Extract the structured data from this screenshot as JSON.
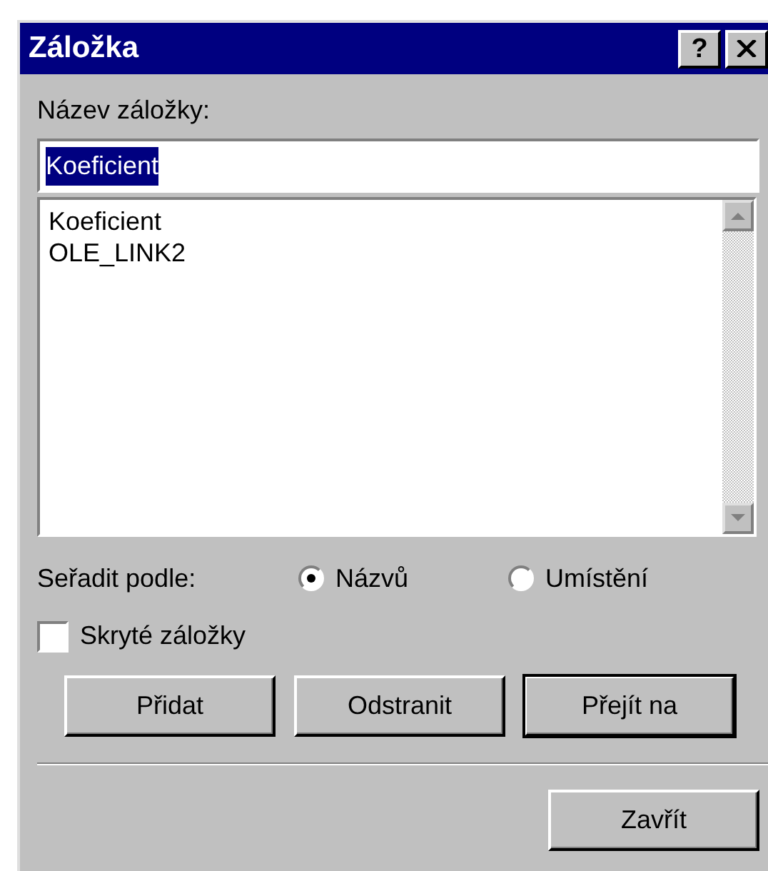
{
  "window": {
    "title": "Záložka"
  },
  "title_buttons": [
    {
      "kind": "help",
      "label": "?"
    },
    {
      "kind": "close"
    }
  ],
  "name_field": {
    "label": "Název záložky:",
    "value": "Koeficient",
    "text_selected": true
  },
  "bookmarks": [
    {
      "label": "Koeficient",
      "selected": false
    },
    {
      "label": "OLE_LINK2",
      "selected": false
    }
  ],
  "sort": {
    "label": "Seřadit podle:",
    "options": [
      {
        "label": "Názvů",
        "selected": true
      },
      {
        "label": "Umístění",
        "selected": false
      }
    ]
  },
  "hidden_checkbox": {
    "label": "Skryté záložky",
    "checked": false
  },
  "buttons": [
    {
      "label": "Přidat",
      "default": false
    },
    {
      "label": "Odstranit",
      "default": false
    },
    {
      "label": "Přejít na",
      "default": true
    }
  ],
  "close_button": {
    "label": "Zavřít"
  }
}
